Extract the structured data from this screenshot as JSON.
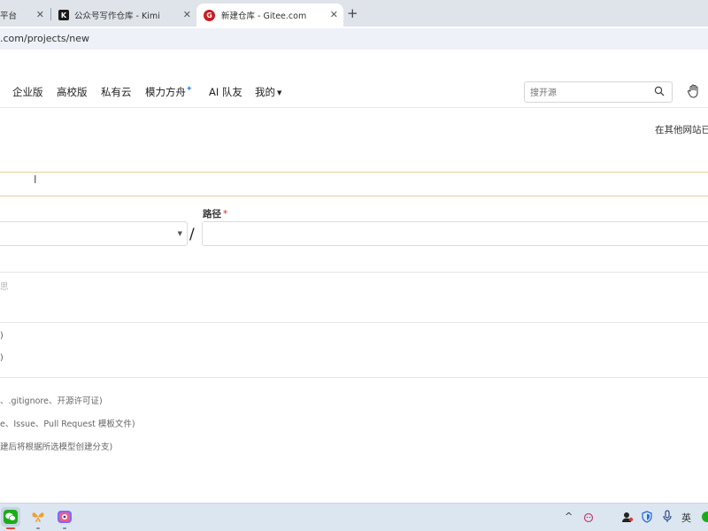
{
  "browser": {
    "tabs": [
      {
        "label": "平台"
      },
      {
        "label": "公众号写作仓库 - Kimi",
        "favicon": "K"
      },
      {
        "label": "新建仓库 - Gitee.com",
        "favicon": "G"
      }
    ],
    "url": ".com/projects/new"
  },
  "nav": {
    "items": [
      "企业版",
      "高校版",
      "私有云",
      "模力方舟",
      "AI 队友",
      "我的"
    ],
    "search_placeholder": "搜开源"
  },
  "form": {
    "import_link": "在其他网站已",
    "path_label": "路径",
    "required_mark": "*",
    "slash": "/",
    "description_placeholder": "思",
    "box2_top": ")",
    "box2_text": ")",
    "options": [
      "、.gitignore、开源许可证)",
      "e、Issue、Pull Request 模板文件)",
      "建后将根据所选模型创建分支)"
    ]
  },
  "taskbar": {
    "tray_lang": "英",
    "tray_caret": "^"
  },
  "colors": {
    "tab_strip": "#dfe4ea",
    "accent_red": "#c71d23",
    "focus_border": "#e7d0a4",
    "taskbar": "#dce6f1"
  }
}
